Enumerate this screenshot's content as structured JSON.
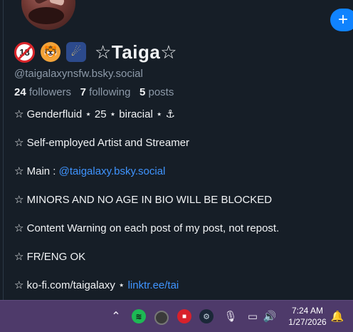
{
  "profile": {
    "fab_label": "+",
    "name_emojis": [
      "18",
      "🐯",
      "☄"
    ],
    "name": "☆Taiga☆",
    "handle": "@taigalaxynsfw.bsky.social",
    "followers_count": "24",
    "followers_label": "followers",
    "following_count": "7",
    "following_label": "following",
    "posts_count": "5",
    "posts_label": "posts",
    "bio": [
      {
        "text": "☆ Genderfluid ⋆ 25 ⋆ biracial ⋆ ⚓"
      },
      {
        "text": "☆ Self-employed Artist and Streamer"
      },
      {
        "prefix": "☆ Main : ",
        "link": "@taigalaxy.bsky.social"
      },
      {
        "text": "☆ MINORS AND NO AGE IN BIO WILL BE BLOCKED"
      },
      {
        "text": "☆ Content Warning on each post of my post, not repost."
      },
      {
        "text": "☆ FR/ENG OK"
      },
      {
        "prefix": "☆ ko-fi.com/taigalaxy ⋆ ",
        "link": "linktr.ee/tai"
      }
    ]
  },
  "taskbar": {
    "tray_icons": [
      "chevron-up-icon",
      "spotify-icon",
      "gray-app-icon",
      "red-app-icon",
      "steam-icon",
      "microphone-icon",
      "display-icon",
      "volume-icon",
      "notification-icon"
    ],
    "time": "7:24 AM",
    "date": "1/27/2026",
    "colors": {
      "background": "#4e3a6a"
    }
  },
  "colors": {
    "background": "#161e27",
    "link": "#3f94ff",
    "accent": "#1083fe",
    "muted": "#8d9aa9"
  }
}
